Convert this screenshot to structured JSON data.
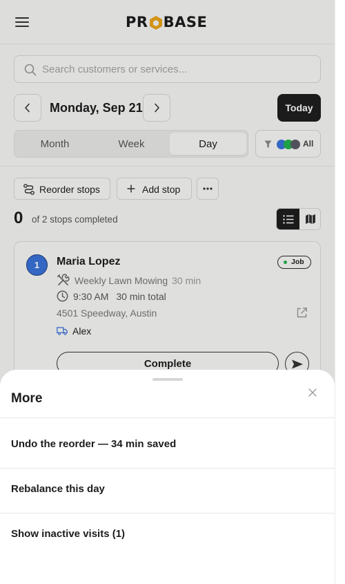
{
  "header": {
    "brand": "PROBASE",
    "brand_left": "PR",
    "brand_right": "BASE"
  },
  "search": {
    "placeholder": "Search customers or services..."
  },
  "date_nav": {
    "label": "Monday, Sep 21",
    "today_label": "Today"
  },
  "views": {
    "items": [
      "Month",
      "Week",
      "Day"
    ],
    "active": "Day"
  },
  "filter": {
    "label": "All",
    "colors": [
      "#3a72d8",
      "#22b14c",
      "#5b5b66"
    ]
  },
  "actions": {
    "reorder_label": "Reorder stops",
    "add_label": "Add stop",
    "more_label": "···"
  },
  "progress": {
    "completed": "0",
    "text": "of 2 stops completed"
  },
  "stop": {
    "number": "1",
    "customer": "Maria Lopez",
    "badge": "Job",
    "service": "Weekly Lawn Mowing",
    "duration": "30 min",
    "time": "9:30 AM",
    "total": "30 min total",
    "address": "4501 Speedway, Austin",
    "technician": "Alex",
    "complete_label": "Complete"
  },
  "sheet": {
    "title": "More",
    "items": [
      "Undo the reorder — 34 min saved",
      "Rebalance this day",
      "Show inactive visits (1)"
    ]
  },
  "colors": {
    "accent": "#3a72d8",
    "brand_hex": "#e8a317",
    "dark": "#1e1e1e",
    "status_green": "#22b14c"
  }
}
